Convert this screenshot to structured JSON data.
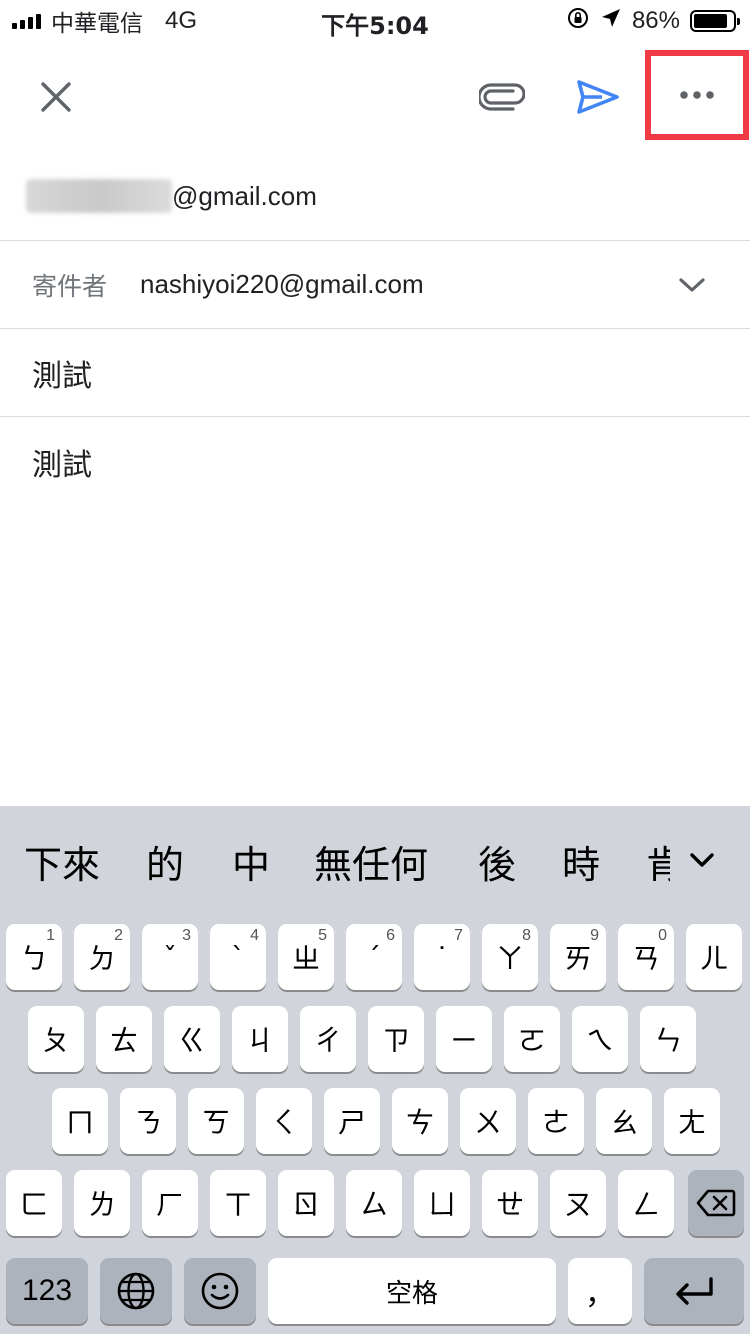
{
  "status_bar": {
    "carrier": "中華電信",
    "network": "4G",
    "time": "下午5:04",
    "battery_percent": "86%",
    "battery_level": 0.86,
    "icons": [
      "lock-rotation-icon",
      "location-arrow-icon",
      "battery-icon"
    ]
  },
  "toolbar": {
    "close_icon": "close-icon",
    "attach_icon": "paperclip-icon",
    "send_icon": "send-icon",
    "more_icon": "more-horizontal-icon",
    "highlight_color": "#ef3b45",
    "send_color": "#4285f4"
  },
  "compose": {
    "to_domain": "@gmail.com",
    "from_label": "寄件者",
    "from_value": "nashiyoi220@gmail.com",
    "subject": "測試",
    "body": "測試"
  },
  "keyboard": {
    "candidates": [
      "下來",
      "的",
      "中",
      "無任何",
      "後",
      "時",
      "肯"
    ],
    "row1": [
      {
        "label": "ㄅ",
        "num": "1"
      },
      {
        "label": "ㄉ",
        "num": "2"
      },
      {
        "label": "ˇ",
        "num": "3"
      },
      {
        "label": "ˋ",
        "num": "4"
      },
      {
        "label": "ㄓ",
        "num": "5"
      },
      {
        "label": "ˊ",
        "num": "6"
      },
      {
        "label": "˙",
        "num": "7"
      },
      {
        "label": "ㄚ",
        "num": "8"
      },
      {
        "label": "ㄞ",
        "num": "9"
      },
      {
        "label": "ㄢ",
        "num": "0"
      },
      {
        "label": "ㄦ",
        "num": ""
      }
    ],
    "row2": [
      "ㄆ",
      "ㄊ",
      "ㄍ",
      "ㄐ",
      "ㄔ",
      "ㄗ",
      "ㄧ",
      "ㄛ",
      "ㄟ",
      "ㄣ"
    ],
    "row3": [
      "ㄇ",
      "ㄋ",
      "ㄎ",
      "ㄑ",
      "ㄕ",
      "ㄘ",
      "ㄨ",
      "ㄜ",
      "ㄠ",
      "ㄤ"
    ],
    "row4": [
      "ㄈ",
      "ㄌ",
      "ㄏ",
      "ㄒ",
      "ㄖ",
      "ㄙ",
      "ㄩ",
      "ㄝ",
      "ㄡ",
      "ㄥ"
    ],
    "numbers_label": "123",
    "space_label": "空格",
    "comma_label": "，"
  }
}
